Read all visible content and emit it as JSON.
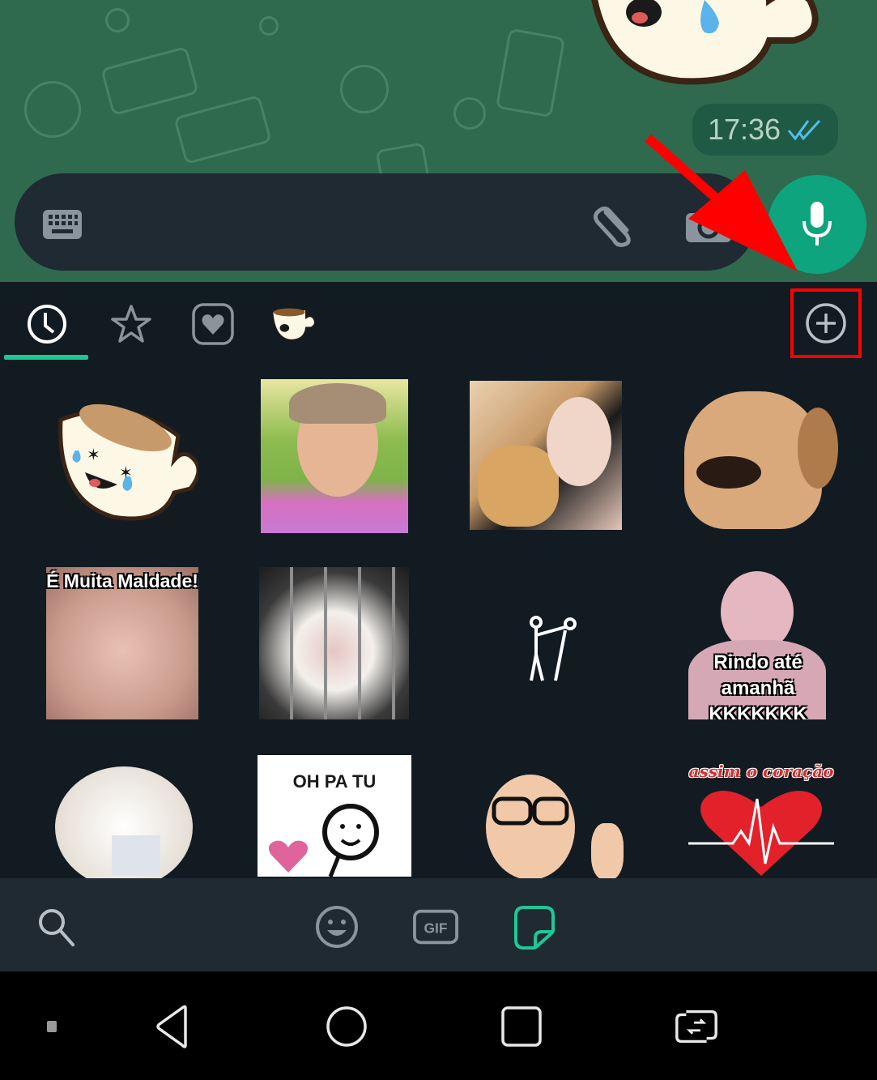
{
  "chat": {
    "message_time": "17:36",
    "message_status": "read",
    "message_type": "sticker"
  },
  "input_bar": {
    "icons": [
      "keyboard-icon",
      "attach-icon",
      "camera-icon"
    ],
    "mic_button": "microphone-icon"
  },
  "annotation": {
    "arrow_color": "#ff0000",
    "highlight_color": "#ff0000",
    "highlight_target": "add-sticker-pack-button"
  },
  "sticker_panel": {
    "tabs": [
      {
        "name": "recent",
        "icon": "clock-icon",
        "active": true
      },
      {
        "name": "favorites",
        "icon": "star-icon",
        "active": false
      },
      {
        "name": "loved",
        "icon": "heart-icon",
        "active": false
      },
      {
        "name": "coffee-pack",
        "icon": "coffee-cup-sticker-icon",
        "active": false
      }
    ],
    "add_button_icon": "plus-circle-icon",
    "stickers": [
      {
        "desc": "crying-laughing coffee cup",
        "caption": ""
      },
      {
        "desc": "girl with funny face",
        "caption": ""
      },
      {
        "desc": "woman and cat laughing",
        "caption": ""
      },
      {
        "desc": "laughing dog",
        "caption": ""
      },
      {
        "desc": "smirking cat",
        "caption": "É Muita Maldade!"
      },
      {
        "desc": "cat behind cage",
        "caption": ""
      },
      {
        "desc": "stick figure dancing",
        "caption": ""
      },
      {
        "desc": "laughing baby",
        "caption": "Rindo até amanhã KKKKKKK"
      },
      {
        "desc": "white pomeranian dog",
        "caption": ""
      },
      {
        "desc": "stick figure with heart",
        "caption": "OH PA TU"
      },
      {
        "desc": "baby with glasses",
        "caption": ""
      },
      {
        "desc": "heartbeat heart",
        "caption": "assim o coração"
      }
    ]
  },
  "bottom_bar": {
    "search_icon": "search-icon",
    "tabs": [
      {
        "name": "emoji",
        "icon": "emoji-icon",
        "active": false
      },
      {
        "name": "gif",
        "label": "GIF",
        "active": false
      },
      {
        "name": "stickers",
        "icon": "sticker-icon",
        "active": true
      }
    ]
  },
  "colors": {
    "accent": "#1fc796",
    "chat_bg": "#2f6a4f",
    "panel_bg": "#121b22",
    "bar_bg": "#1f2a33",
    "mic": "#0ea47e",
    "read_ticks": "#53bdeb"
  },
  "nav_bar": {
    "buttons": [
      "dot-icon",
      "back-icon",
      "home-icon",
      "recents-icon",
      "switch-apps-icon"
    ]
  }
}
